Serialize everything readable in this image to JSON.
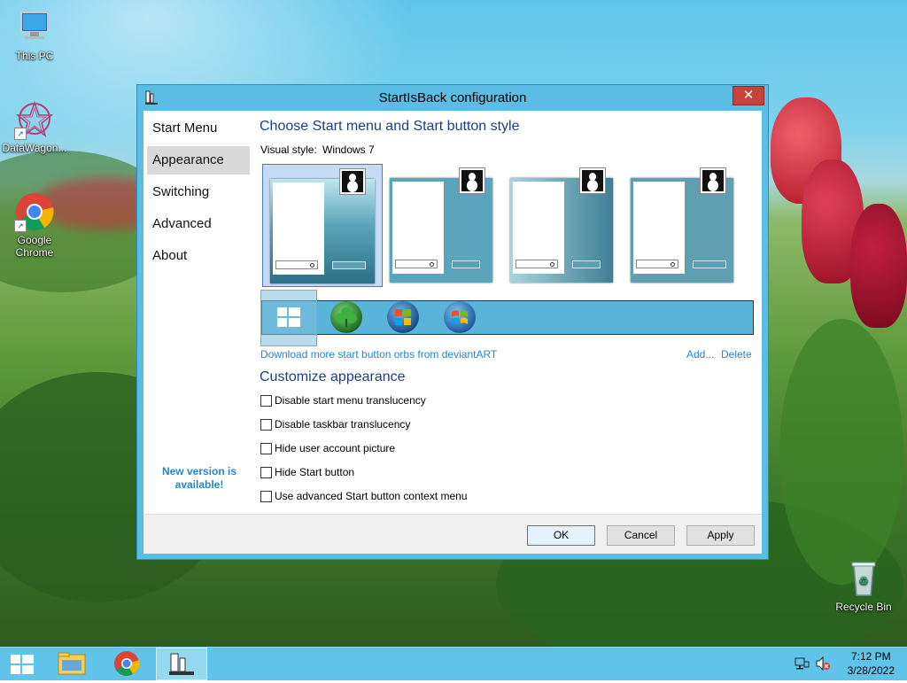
{
  "desktop": {
    "icons": [
      {
        "label": "This PC"
      },
      {
        "label": "DataWagon..."
      },
      {
        "label": "Google Chrome"
      },
      {
        "label": "Recycle Bin"
      }
    ]
  },
  "dialog": {
    "title": "StartIsBack configuration",
    "close_label": "✕",
    "nav": [
      {
        "label": "Start Menu"
      },
      {
        "label": "Appearance"
      },
      {
        "label": "Switching"
      },
      {
        "label": "Advanced"
      },
      {
        "label": "About"
      }
    ],
    "new_version": "New version is available!",
    "section1_heading": "Choose Start menu and Start button style",
    "visual_style_label": "Visual style:",
    "visual_style_value": "Windows 7",
    "orbs_link": "Download more start button orbs from deviantART",
    "add_link": "Add...",
    "delete_link": "Delete",
    "section2_heading": "Customize appearance",
    "options": [
      {
        "label": "Disable start menu translucency",
        "checked": false
      },
      {
        "label": "Disable taskbar translucency",
        "checked": false
      },
      {
        "label": "Hide user account picture",
        "checked": false
      },
      {
        "label": "Hide Start button",
        "checked": false
      },
      {
        "label": "Use advanced Start button context menu",
        "checked": false
      }
    ],
    "buttons": {
      "ok": "OK",
      "cancel": "Cancel",
      "apply": "Apply"
    }
  },
  "taskbar": {
    "time": "7:12 PM",
    "date": "3/28/2022"
  },
  "colors": {
    "taskbar": "#60c3ea",
    "window_frame": "#5bbde4",
    "close_button": "#c7433a",
    "link": "#2a86c7",
    "heading": "#1c3e8c"
  }
}
